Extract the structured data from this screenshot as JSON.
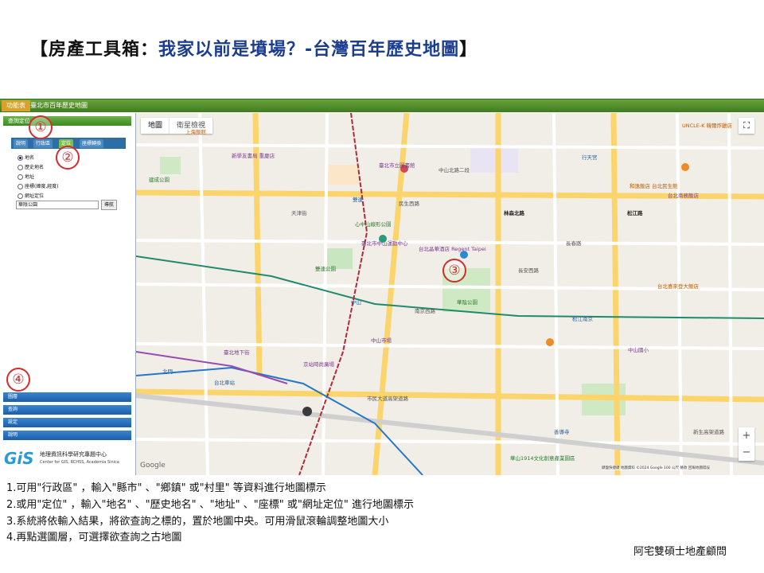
{
  "slide": {
    "title_bracket_open": "【",
    "title_prefix": "房產工具箱：",
    "title_main": "我家以前是墳場？-台灣百年歷史地圖",
    "title_bracket_close": "】",
    "author": "阿宅雙碩士地產顧問"
  },
  "topbar": {
    "home_label": "功能表",
    "title": "臺北市百年歷史地圖"
  },
  "left_panel": {
    "header": "查詢定位",
    "tabs": [
      {
        "label": "說明",
        "active": false
      },
      {
        "label": "行政區",
        "active": false
      },
      {
        "label": "定位",
        "active": true
      },
      {
        "label": "座標轉換",
        "active": false
      }
    ],
    "radio_options": [
      {
        "label": "地名",
        "selected": true
      },
      {
        "label": "歷史地名",
        "selected": false
      },
      {
        "label": "地址",
        "selected": false
      },
      {
        "label": "座標(緯度,經度)",
        "selected": false
      },
      {
        "label": "網址定位",
        "selected": false
      }
    ],
    "search_value": "華陰公園",
    "search_button": "導航",
    "accordion": [
      "圖層",
      "查詢",
      "設定",
      "說明"
    ],
    "gis_logo": "GiS",
    "gis_title": "地理資訊科學研究專題中心",
    "gis_subtitle": "Center for GIS, RCHSS, Academia Sinica"
  },
  "map": {
    "type_buttons": [
      "地圖",
      "衛星檢視"
    ],
    "fullscreen_icon": "fullscreen-icon",
    "zoom_in": "+",
    "zoom_out": "−",
    "attribution": "鍵盤快捷鍵  地圖資料 ©2024 Google  100 公尺  條款  回報地圖錯誤",
    "google_label": "Google",
    "labels": [
      {
        "text": "上海飯館",
        "cls": "food"
      },
      {
        "text": "新學友書局 重慶店",
        "cls": "poi"
      },
      {
        "text": "臺北市立圖書館",
        "cls": "poi"
      },
      {
        "text": "中山北路二段",
        "cls": ""
      },
      {
        "text": "雙連",
        "cls": "transit"
      },
      {
        "text": "台北晶華酒店 Regent Taipei",
        "cls": "poi"
      },
      {
        "text": "心中山線形公園",
        "cls": "park"
      },
      {
        "text": "臺北市中山運動中心",
        "cls": "poi"
      },
      {
        "text": "華陰公園",
        "cls": "park"
      },
      {
        "text": "長安西路",
        "cls": ""
      },
      {
        "text": "中山",
        "cls": "transit"
      },
      {
        "text": "南京西路",
        "cls": ""
      },
      {
        "text": "林森北路",
        "cls": ""
      },
      {
        "text": "中山市場",
        "cls": "poi"
      },
      {
        "text": "京站時尚廣場",
        "cls": "poi"
      },
      {
        "text": "台北車站",
        "cls": "transit"
      },
      {
        "text": "市民大道高架道路",
        "cls": ""
      },
      {
        "text": "北門",
        "cls": "transit"
      },
      {
        "text": "臺北地下街",
        "cls": "poi"
      },
      {
        "text": "松江南京",
        "cls": "transit"
      },
      {
        "text": "行天宮",
        "cls": "transit"
      },
      {
        "text": "和逸飯店 台北民生館",
        "cls": "food"
      },
      {
        "text": "台北喜來登大飯店",
        "cls": "food"
      },
      {
        "text": "台北商務飯店",
        "cls": "poi"
      },
      {
        "text": "華山1914文化創意產業園區",
        "cls": "park"
      },
      {
        "text": "善導寺",
        "cls": "transit"
      },
      {
        "text": "UNCLE-K 韓爾炸雞店",
        "cls": "food"
      },
      {
        "text": "松江路",
        "cls": "bold"
      },
      {
        "text": "民生西路",
        "cls": ""
      },
      {
        "text": "天津街",
        "cls": ""
      },
      {
        "text": "中山國小",
        "cls": "poi"
      },
      {
        "text": "建成公園",
        "cls": "park"
      },
      {
        "text": "雙連公園",
        "cls": "park"
      },
      {
        "text": "長春路",
        "cls": ""
      },
      {
        "text": "新生高架道路",
        "cls": ""
      }
    ]
  },
  "callouts": [
    "①",
    "②",
    "③",
    "④"
  ],
  "instructions": [
    "1.可用\"行政區\" ，輸入\"縣市\" 、\"鄉鎮\" 或\"村里\" 等資料進行地圖標示",
    "2.或用\"定位\" ，輸入\"地名\" 、\"歷史地名\" 、\"地址\" 、\"座標\" 或\"網址定位\" 進行地圖標示",
    "3.系統將依輸入結果，將欲查詢之標的，置於地圖中央。可用滑鼠滾輪調整地圖大小",
    "4.再點選圖層，可選擇欲查詢之古地圖"
  ]
}
